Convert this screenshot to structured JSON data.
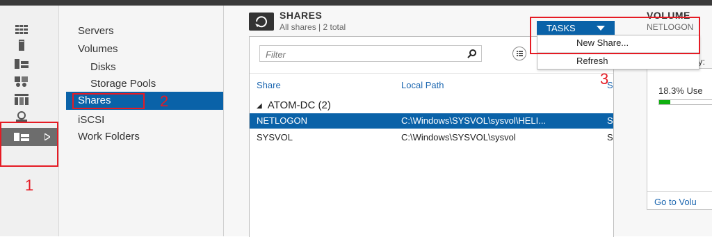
{
  "nav": {
    "items": [
      "Servers",
      "Volumes",
      "Disks",
      "Storage Pools",
      "Shares",
      "iSCSI",
      "Work Folders"
    ]
  },
  "shares": {
    "title": "SHARES",
    "subtitle": "All shares | 2 total",
    "filter_placeholder": "Filter",
    "columns": [
      "Share",
      "Local Path",
      "S"
    ],
    "group_label": "ATOM-DC (2)",
    "rows": [
      {
        "share": "NETLOGON",
        "path": "C:\\Windows\\SYSVOL\\sysvol\\HELI...",
        "extra": "S"
      },
      {
        "share": "SYSVOL",
        "path": "C:\\Windows\\SYSVOL\\sysvol",
        "extra": "S"
      }
    ]
  },
  "tasks": {
    "label": "TASKS",
    "menu": [
      "New Share...",
      "Refresh"
    ]
  },
  "volume": {
    "title": "VOLUME",
    "subtitle": "NETLOGON",
    "capacity_label": "y:",
    "usage_text": "18.3% Use",
    "usage_fraction": 0.183,
    "footer_link": "Go to Volu"
  },
  "annotations": [
    "1",
    "2",
    "3"
  ],
  "colors": {
    "accent": "#0a62a8",
    "annotation": "#e51b24",
    "usage_bar": "#10b010"
  }
}
